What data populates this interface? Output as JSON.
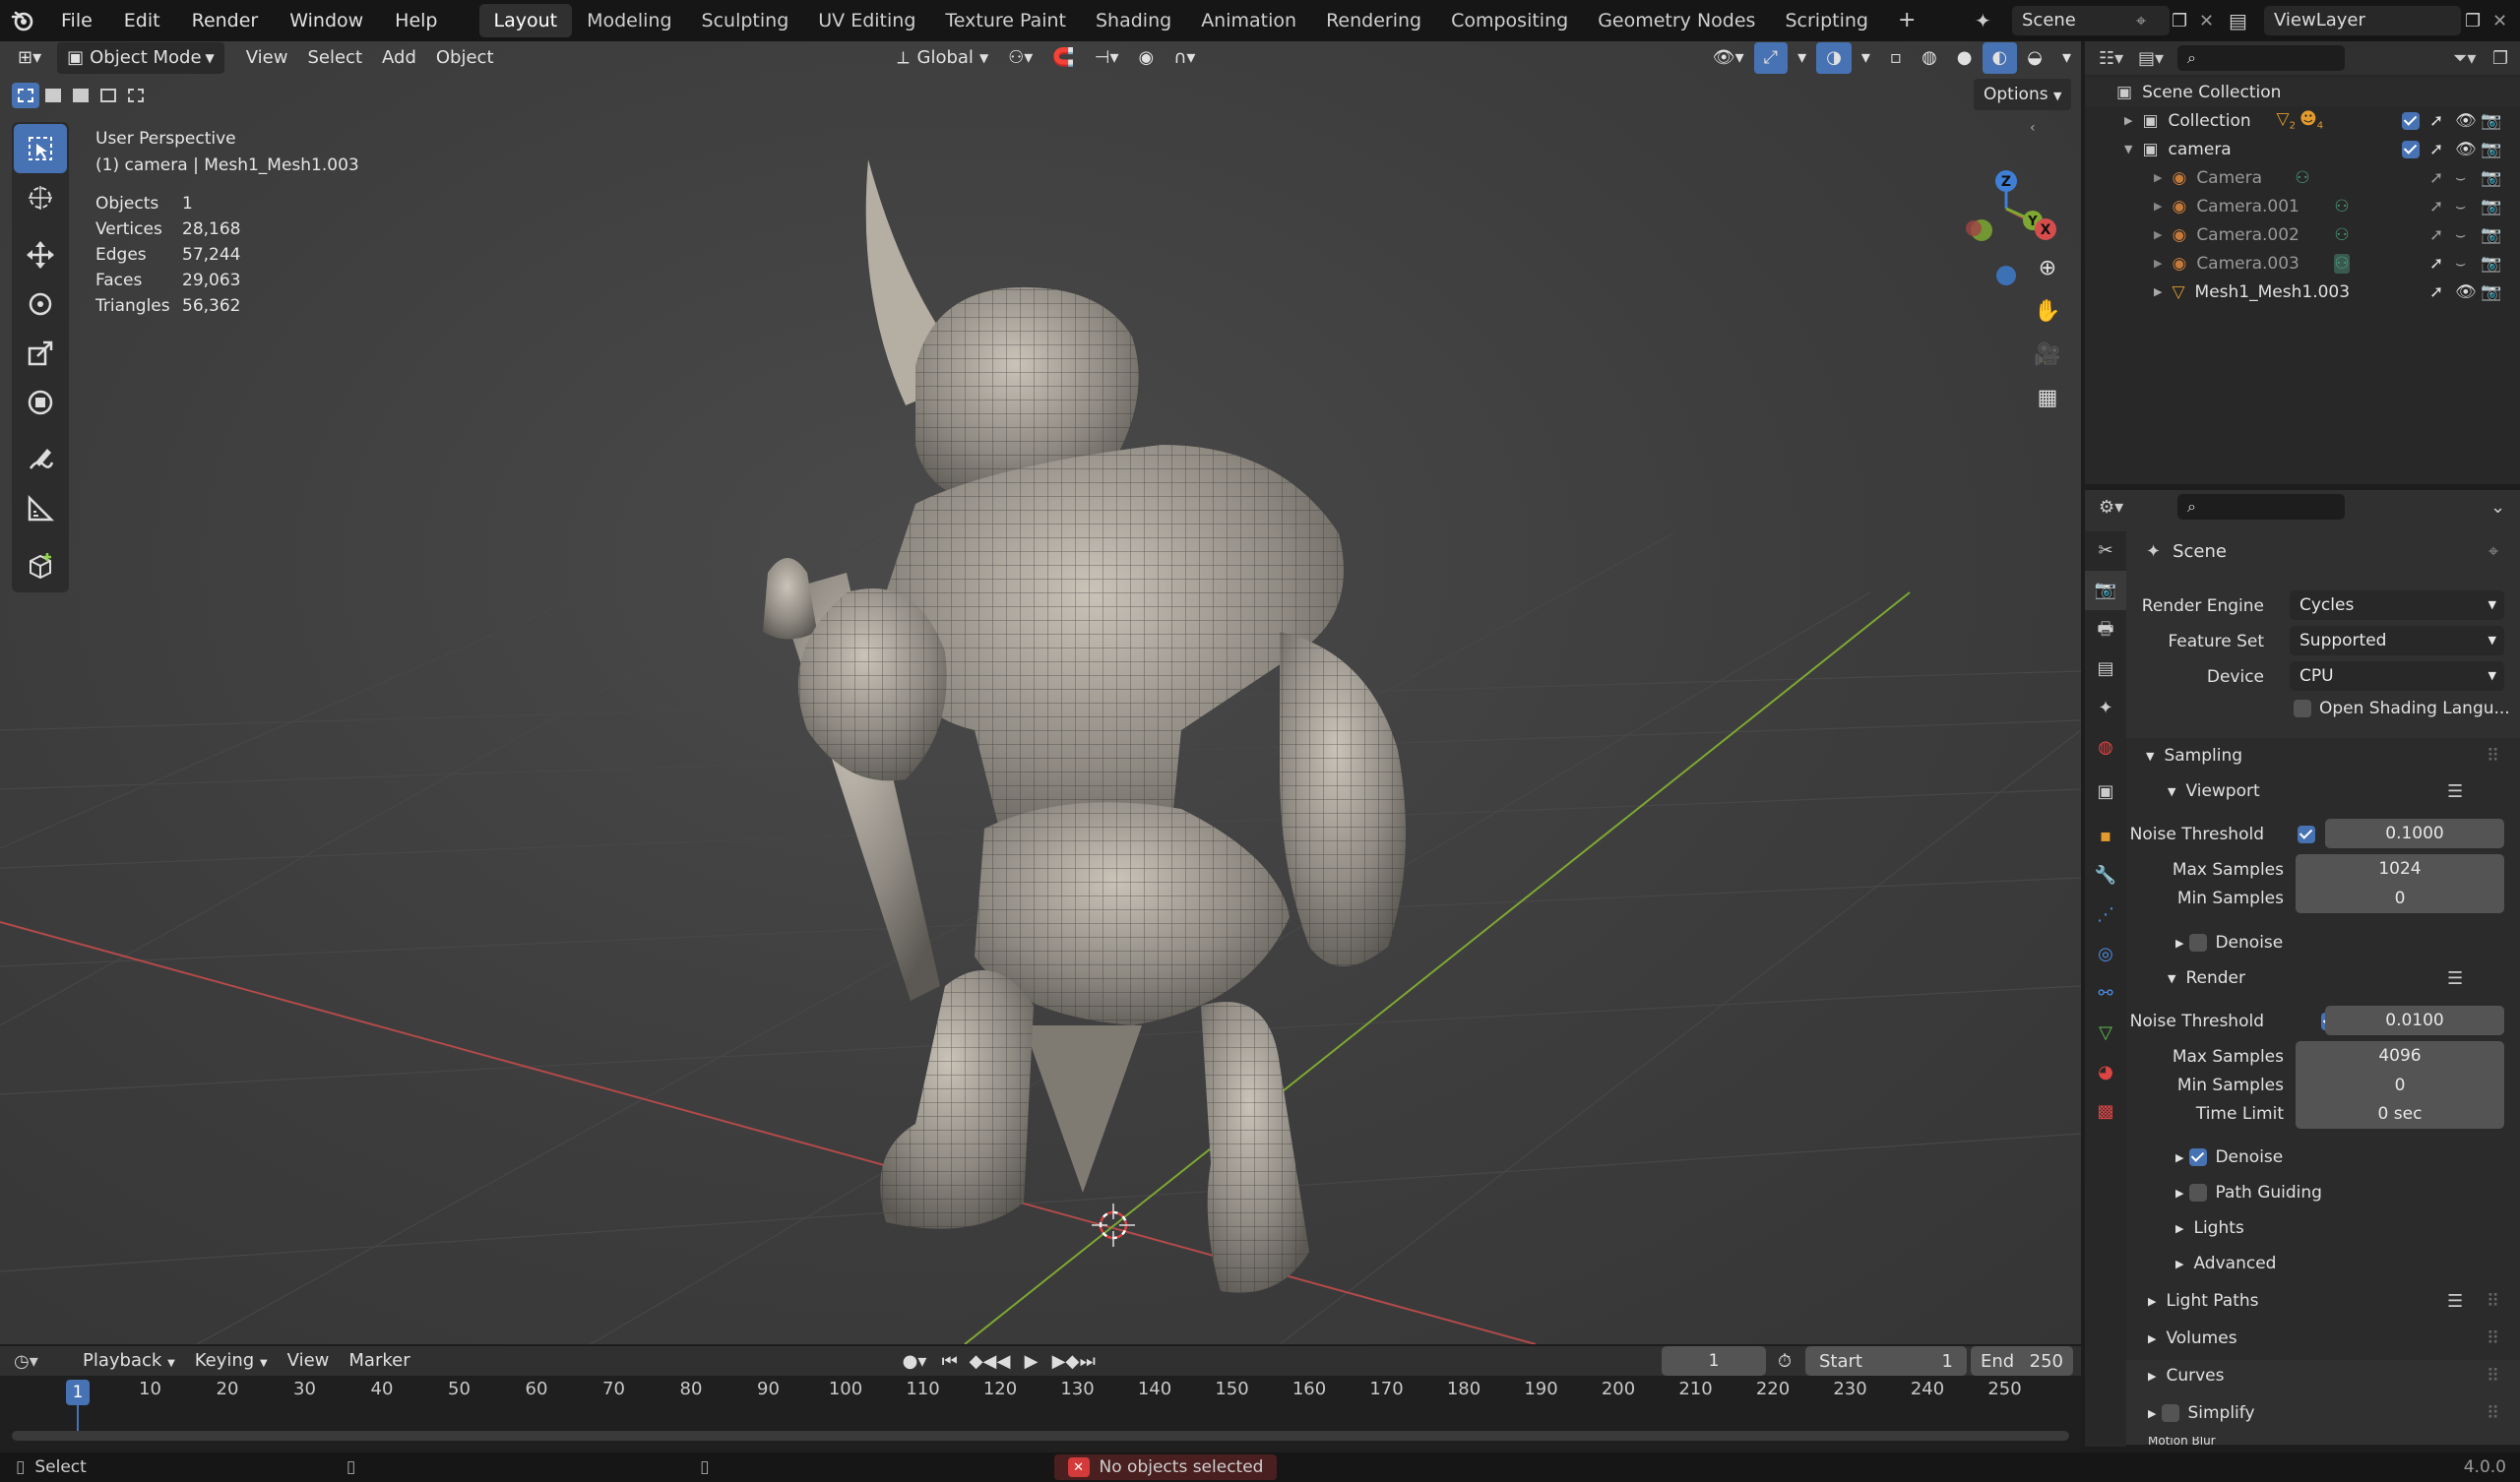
{
  "topbar": {
    "menus": [
      "File",
      "Edit",
      "Render",
      "Window",
      "Help"
    ],
    "workspaces": [
      "Layout",
      "Modeling",
      "Sculpting",
      "UV Editing",
      "Texture Paint",
      "Shading",
      "Animation",
      "Rendering",
      "Compositing",
      "Geometry Nodes",
      "Scripting"
    ],
    "active_workspace": "Layout",
    "scene": "Scene",
    "view_layer": "ViewLayer"
  },
  "viewport_header": {
    "mode": "Object Mode",
    "menus": [
      "View",
      "Select",
      "Add",
      "Object"
    ],
    "transform_orientation": "Global",
    "options": "Options"
  },
  "overlay": {
    "view_name": "User Perspective",
    "context": "(1) camera | Mesh1_Mesh1.003",
    "stats": [
      {
        "label": "Objects",
        "value": "1"
      },
      {
        "label": "Vertices",
        "value": "28,168"
      },
      {
        "label": "Edges",
        "value": "57,244"
      },
      {
        "label": "Faces",
        "value": "29,063"
      },
      {
        "label": "Triangles",
        "value": "56,362"
      }
    ]
  },
  "gizmo": {
    "z": "Z",
    "y": "Y",
    "x": "X"
  },
  "outliner": {
    "root": "Scene Collection",
    "items": [
      {
        "name": "Collection",
        "level": 1,
        "counts": [
          "2",
          "4"
        ]
      },
      {
        "name": "camera",
        "level": 1
      },
      {
        "name": "Camera",
        "level": 2
      },
      {
        "name": "Camera.001",
        "level": 2
      },
      {
        "name": "Camera.002",
        "level": 2
      },
      {
        "name": "Camera.003",
        "level": 2
      },
      {
        "name": "Mesh1_Mesh1.003",
        "level": 2
      }
    ]
  },
  "properties": {
    "context": "Scene",
    "render_engine_label": "Render Engine",
    "render_engine": "Cycles",
    "feature_set_label": "Feature Set",
    "feature_set": "Supported",
    "device_label": "Device",
    "device": "CPU",
    "osl_label": "Open Shading Langu...",
    "sampling": "Sampling",
    "viewport": "Viewport",
    "noise_threshold_label": "Noise Threshold",
    "max_samples_label": "Max Samples",
    "min_samples_label": "Min Samples",
    "time_limit_label": "Time Limit",
    "vp_noise": "0.1000",
    "vp_max": "1024",
    "vp_min": "0",
    "denoise": "Denoise",
    "render": "Render",
    "r_noise": "0.0100",
    "r_max": "4096",
    "r_min": "0",
    "r_time": "0 sec",
    "path_guiding": "Path Guiding",
    "lights": "Lights",
    "advanced": "Advanced",
    "light_paths": "Light Paths",
    "volumes": "Volumes",
    "curves": "Curves",
    "simplify": "Simplify",
    "motion_blur": "Motion Blur"
  },
  "timeline": {
    "menus": [
      "Playback",
      "Keying",
      "View",
      "Marker"
    ],
    "current_frame": "1",
    "start_label": "Start",
    "start": "1",
    "end_label": "End",
    "end": "250",
    "ticks": [
      "10",
      "20",
      "30",
      "40",
      "50",
      "60",
      "70",
      "80",
      "90",
      "100",
      "110",
      "120",
      "130",
      "140",
      "150",
      "160",
      "170",
      "180",
      "190",
      "200",
      "210",
      "220",
      "230",
      "240",
      "250"
    ]
  },
  "status": {
    "select": "Select",
    "message": "No objects selected",
    "version": "4.0.0"
  },
  "colors": {
    "accent": "#4772b3",
    "x_axis": "#b34a4a",
    "y_axis": "#7ea832",
    "z_axis": "#3f7fd6",
    "error": "#d43a3a"
  }
}
